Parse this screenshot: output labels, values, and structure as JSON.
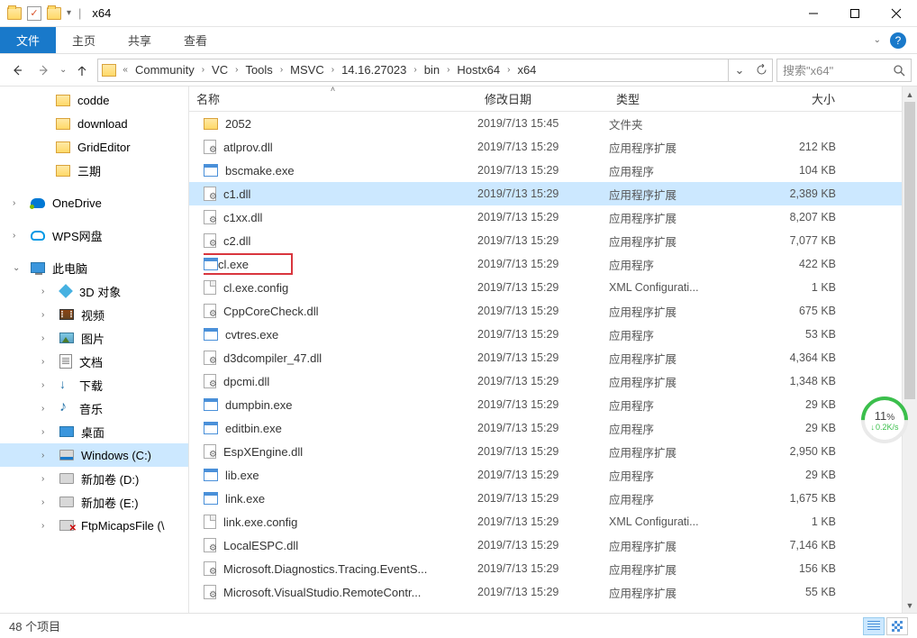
{
  "title": {
    "text": "x64"
  },
  "ribbon": {
    "file": "文件",
    "tabs": [
      "主页",
      "共享",
      "查看"
    ]
  },
  "address": {
    "segments": [
      "Community",
      "VC",
      "Tools",
      "MSVC",
      "14.16.27023",
      "bin",
      "Hostx64",
      "x64"
    ]
  },
  "search": {
    "placeholder": "搜索\"x64\""
  },
  "sidebar": {
    "quick": [
      {
        "label": "codde"
      },
      {
        "label": "download"
      },
      {
        "label": "GridEditor"
      },
      {
        "label": "三期"
      }
    ],
    "onedrive": "OneDrive",
    "wps": "WPS网盘",
    "pc": {
      "label": "此电脑",
      "children": [
        {
          "icon": "3d",
          "label": "3D 对象"
        },
        {
          "icon": "video",
          "label": "视频"
        },
        {
          "icon": "img",
          "label": "图片"
        },
        {
          "icon": "doc",
          "label": "文档"
        },
        {
          "icon": "dl",
          "label": "下载"
        },
        {
          "icon": "music",
          "label": "音乐"
        },
        {
          "icon": "desktop",
          "label": "桌面"
        },
        {
          "icon": "diskc",
          "label": "Windows (C:)",
          "selected": true
        },
        {
          "icon": "disk",
          "label": "新加卷 (D:)"
        },
        {
          "icon": "disk",
          "label": "新加卷 (E:)"
        },
        {
          "icon": "netdisk",
          "label": "FtpMicapsFile (\\"
        }
      ]
    }
  },
  "columns": {
    "name": "名称",
    "date": "修改日期",
    "type": "类型",
    "size": "大小"
  },
  "files": [
    {
      "icon": "folder",
      "name": "2052",
      "date": "2019/7/13 15:45",
      "type": "文件夹",
      "size": ""
    },
    {
      "icon": "dll",
      "name": "atlprov.dll",
      "date": "2019/7/13 15:29",
      "type": "应用程序扩展",
      "size": "212 KB"
    },
    {
      "icon": "exe",
      "name": "bscmake.exe",
      "date": "2019/7/13 15:29",
      "type": "应用程序",
      "size": "104 KB"
    },
    {
      "icon": "dll",
      "name": "c1.dll",
      "date": "2019/7/13 15:29",
      "type": "应用程序扩展",
      "size": "2,389 KB",
      "selected": true
    },
    {
      "icon": "dll",
      "name": "c1xx.dll",
      "date": "2019/7/13 15:29",
      "type": "应用程序扩展",
      "size": "8,207 KB"
    },
    {
      "icon": "dll",
      "name": "c2.dll",
      "date": "2019/7/13 15:29",
      "type": "应用程序扩展",
      "size": "7,077 KB"
    },
    {
      "icon": "exe",
      "name": "cl.exe",
      "date": "2019/7/13 15:29",
      "type": "应用程序",
      "size": "422 KB",
      "highlighted": true
    },
    {
      "icon": "config",
      "name": "cl.exe.config",
      "date": "2019/7/13 15:29",
      "type": "XML Configurati...",
      "size": "1 KB"
    },
    {
      "icon": "dll",
      "name": "CppCoreCheck.dll",
      "date": "2019/7/13 15:29",
      "type": "应用程序扩展",
      "size": "675 KB"
    },
    {
      "icon": "exe",
      "name": "cvtres.exe",
      "date": "2019/7/13 15:29",
      "type": "应用程序",
      "size": "53 KB"
    },
    {
      "icon": "dll",
      "name": "d3dcompiler_47.dll",
      "date": "2019/7/13 15:29",
      "type": "应用程序扩展",
      "size": "4,364 KB"
    },
    {
      "icon": "dll",
      "name": "dpcmi.dll",
      "date": "2019/7/13 15:29",
      "type": "应用程序扩展",
      "size": "1,348 KB"
    },
    {
      "icon": "exe",
      "name": "dumpbin.exe",
      "date": "2019/7/13 15:29",
      "type": "应用程序",
      "size": "29 KB"
    },
    {
      "icon": "exe",
      "name": "editbin.exe",
      "date": "2019/7/13 15:29",
      "type": "应用程序",
      "size": "29 KB"
    },
    {
      "icon": "dll",
      "name": "EspXEngine.dll",
      "date": "2019/7/13 15:29",
      "type": "应用程序扩展",
      "size": "2,950 KB"
    },
    {
      "icon": "exe",
      "name": "lib.exe",
      "date": "2019/7/13 15:29",
      "type": "应用程序",
      "size": "29 KB"
    },
    {
      "icon": "exe",
      "name": "link.exe",
      "date": "2019/7/13 15:29",
      "type": "应用程序",
      "size": "1,675 KB"
    },
    {
      "icon": "config",
      "name": "link.exe.config",
      "date": "2019/7/13 15:29",
      "type": "XML Configurati...",
      "size": "1 KB"
    },
    {
      "icon": "dll",
      "name": "LocalESPC.dll",
      "date": "2019/7/13 15:29",
      "type": "应用程序扩展",
      "size": "7,146 KB"
    },
    {
      "icon": "dll",
      "name": "Microsoft.Diagnostics.Tracing.EventS...",
      "date": "2019/7/13 15:29",
      "type": "应用程序扩展",
      "size": "156 KB"
    },
    {
      "icon": "dll",
      "name": "Microsoft.VisualStudio.RemoteContr...",
      "date": "2019/7/13 15:29",
      "type": "应用程序扩展",
      "size": "55 KB"
    }
  ],
  "status": {
    "text": "48 个项目"
  },
  "speed": {
    "pct": "11",
    "rate": "0.2K/s"
  }
}
